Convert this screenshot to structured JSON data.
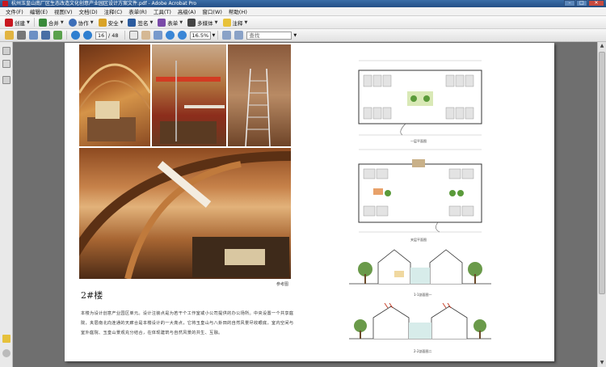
{
  "window": {
    "title": "杭州玉皇山南厂区生态改造文化创意产业园区设计方案文件.pdf - Adobe Acrobat Pro",
    "btn_min": "–",
    "btn_max": "□",
    "btn_close": "✕"
  },
  "menu": [
    "文件(F)",
    "编辑(E)",
    "视图(V)",
    "文档(D)",
    "注释(C)",
    "表单(R)",
    "工具(T)",
    "高级(A)",
    "窗口(W)",
    "帮助(H)"
  ],
  "toolbar": {
    "create": "创建",
    "combine": "合并",
    "collaborate": "协作",
    "secure": "安全",
    "sign": "签名",
    "forms": "表单",
    "multimedia": "多媒体",
    "comment": "注释"
  },
  "nav": {
    "page_current": "16",
    "page_total": "/ 48",
    "zoom": "16.5%",
    "search_placeholder": "查找"
  },
  "page": {
    "photo_caption": "参考图",
    "heading": "2#楼",
    "body_text": "本楼为设计创意产业园区单元。设计注装点是为若干个工作室或小公司提供的办公场所。中央设置一个共享庭院，夹层南北向连通的天廊合是本楼设计的一大亮点，它将玉皇山与八卦田的自然风景尽收眼底，室内空间与室外庭院、玉皇山景观充分结合，在体现建筑与自然风景的共生、互融。",
    "plans": [
      {
        "caption": "一层平面图"
      },
      {
        "caption": "夹层平面图"
      },
      {
        "caption": "1-1剖面图一"
      },
      {
        "caption": "2-2剖面图二"
      }
    ]
  },
  "colors": {
    "title_bar": "#2f5f99",
    "toolbar_bg": "#ececec",
    "viewer_bg": "#6f6f6f",
    "page_bg": "#ffffff"
  }
}
